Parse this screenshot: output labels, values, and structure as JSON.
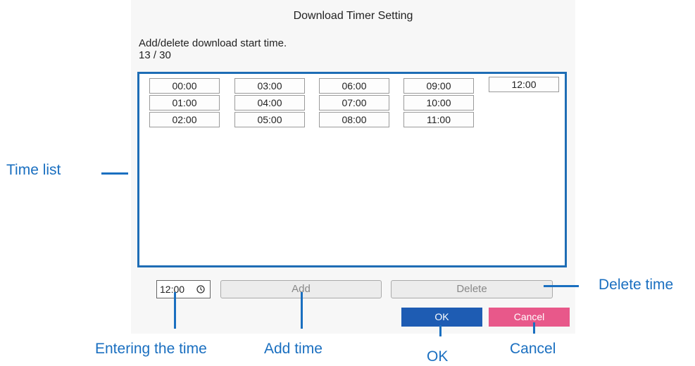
{
  "dialog": {
    "title": "Download Timer Setting",
    "description": "Add/delete download start time.",
    "count": "13 / 30"
  },
  "time_list": {
    "times": [
      "00:00",
      "01:00",
      "02:00",
      "03:00",
      "04:00",
      "05:00",
      "06:00",
      "07:00",
      "08:00",
      "09:00",
      "10:00",
      "11:00",
      "12:00"
    ]
  },
  "controls": {
    "time_input_value": "12:00",
    "add_label": "Add",
    "delete_label": "Delete",
    "ok_label": "OK",
    "cancel_label": "Cancel"
  },
  "callouts": {
    "time_list": "Time list",
    "delete_time": "Delete time",
    "entering_time": "Entering the time",
    "add_time": "Add time",
    "ok": "OK",
    "cancel": "Cancel"
  },
  "colors": {
    "accent_blue": "#1e5cb3",
    "cancel_pink": "#e8588a",
    "callout_blue": "#1a6fc0"
  },
  "icons": {
    "time_input_icon": "clock-icon"
  }
}
